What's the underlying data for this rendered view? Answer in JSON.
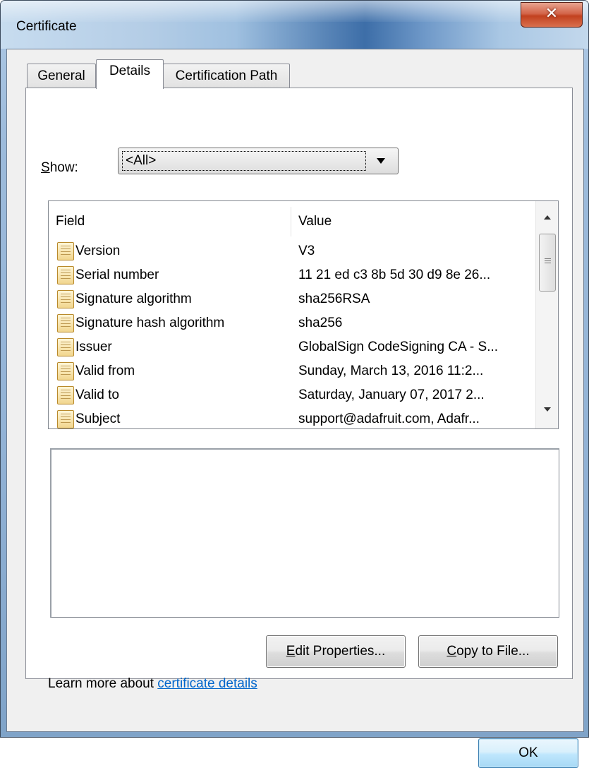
{
  "window": {
    "title": "Certificate",
    "close_glyph": "✕"
  },
  "tabs": [
    {
      "label": "General",
      "active": false
    },
    {
      "label": "Details",
      "active": true
    },
    {
      "label": "Certification Path",
      "active": false
    }
  ],
  "show": {
    "label_prefix": "S",
    "label_rest": "how:",
    "selected": "<All>"
  },
  "list": {
    "columns": [
      "Field",
      "Value"
    ],
    "rows": [
      {
        "field": "Version",
        "value": "V3"
      },
      {
        "field": "Serial number",
        "value": "11 21 ed c3 8b 5d 30 d9 8e 26..."
      },
      {
        "field": "Signature algorithm",
        "value": "sha256RSA"
      },
      {
        "field": "Signature hash algorithm",
        "value": "sha256"
      },
      {
        "field": "Issuer",
        "value": "GlobalSign CodeSigning CA - S..."
      },
      {
        "field": "Valid from",
        "value": "Sunday, March 13, 2016 11:2..."
      },
      {
        "field": "Valid to",
        "value": "Saturday, January 07, 2017 2..."
      },
      {
        "field": "Subject",
        "value": "support@adafruit.com, Adafr..."
      }
    ],
    "row_icon": "certificate-field-icon"
  },
  "buttons": {
    "edit_prefix": "E",
    "edit_rest": "dit Properties...",
    "copy_prefix": "C",
    "copy_rest": "opy to File...",
    "ok": "OK"
  },
  "learn_more": {
    "text": "Learn more about ",
    "link": "certificate details"
  },
  "colors": {
    "link": "#0066cc",
    "close_button": "#c2411f",
    "ok_border": "#3c7fb1"
  }
}
